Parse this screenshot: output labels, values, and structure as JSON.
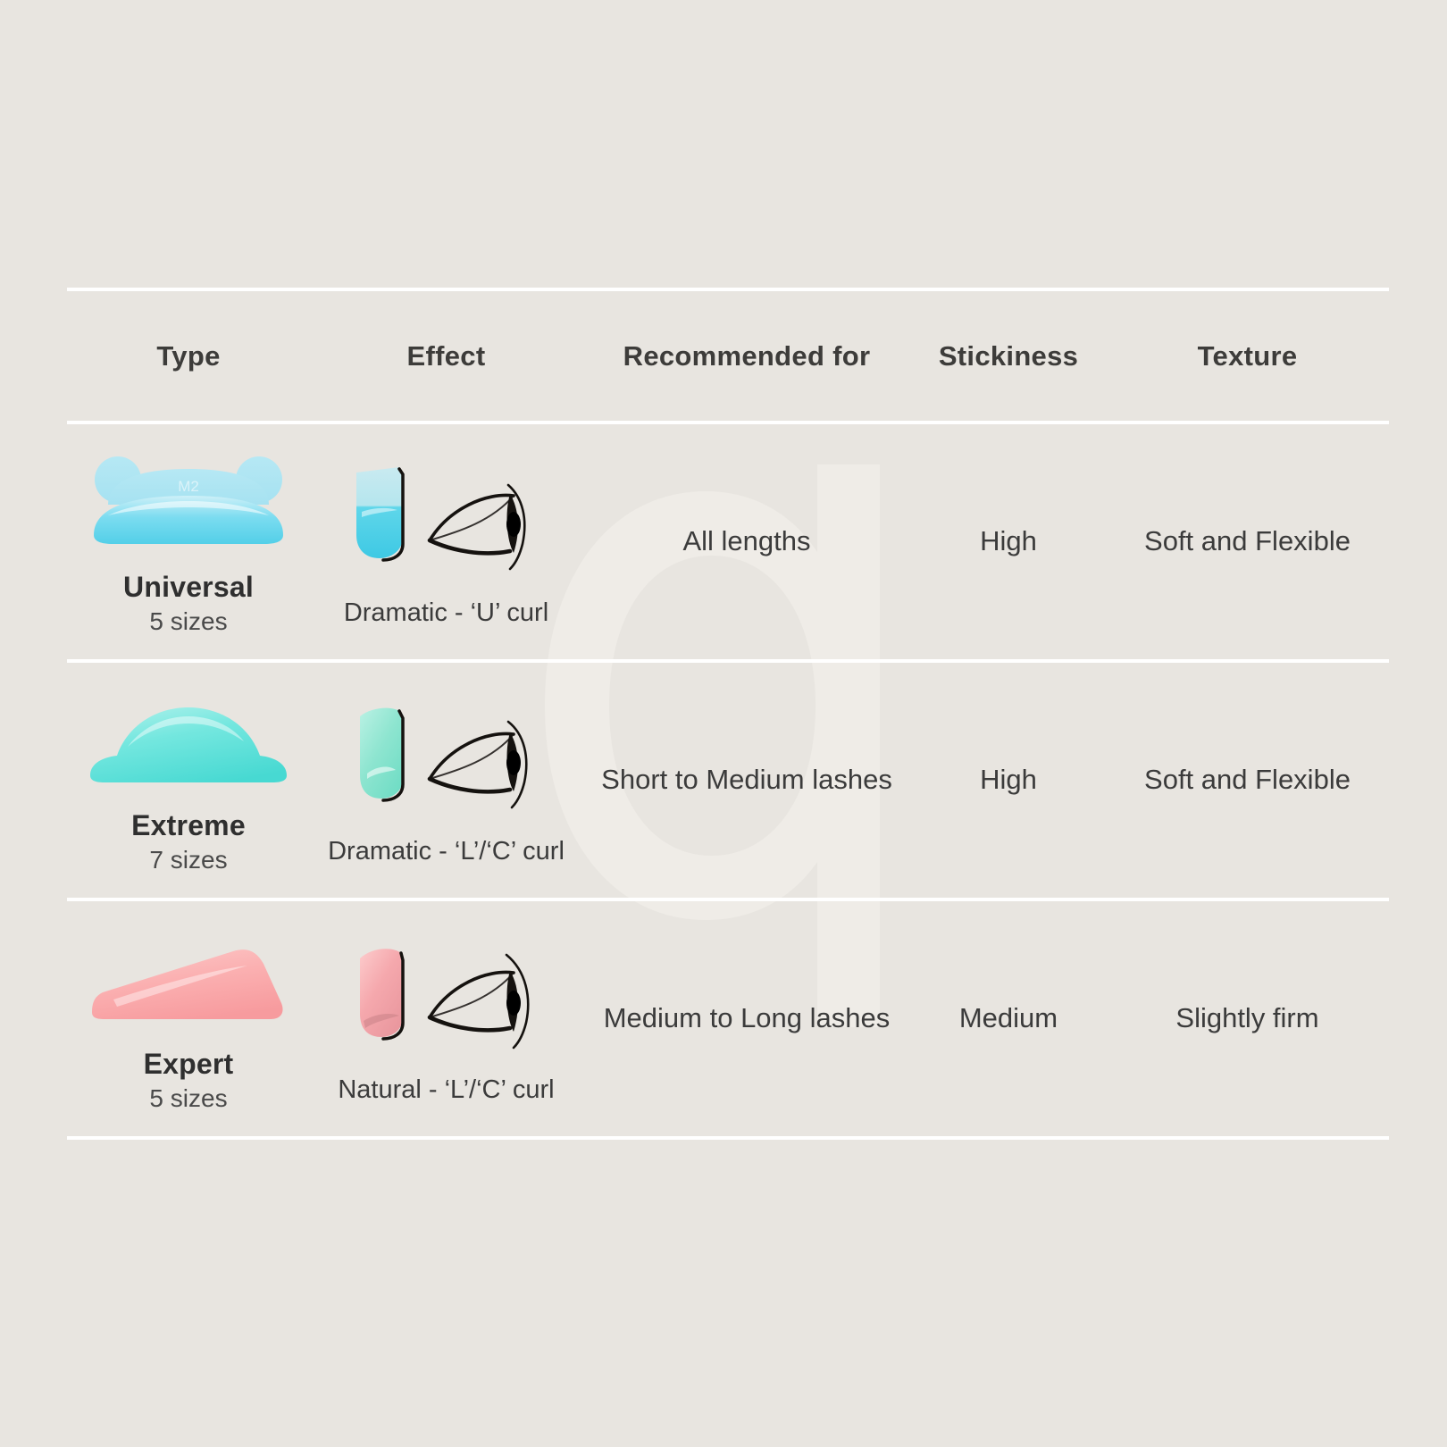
{
  "page": {
    "background_color": "#e8e5e0",
    "divider_color": "#ffffff",
    "watermark_letter": "a"
  },
  "table": {
    "headers": [
      {
        "key": "type",
        "label": "Type"
      },
      {
        "key": "effect",
        "label": "Effect"
      },
      {
        "key": "recommend",
        "label": "Recommended for"
      },
      {
        "key": "sticky",
        "label": "Stickiness"
      },
      {
        "key": "texture",
        "label": "Texture"
      }
    ],
    "rows": [
      {
        "type_name": "Universal",
        "type_sizes": "5 sizes",
        "pad_label": "M2",
        "pad_color": "#9fe4f2",
        "pad_color_deep": "#55cde8",
        "swatch_color": "#4fd4ec",
        "swatch_color_light": "#b9e8ef",
        "effect_label": "Dramatic - ‘U’ curl",
        "recommended_for": "All lengths",
        "stickiness": "High",
        "texture": "Soft and Flexible"
      },
      {
        "type_name": "Extreme",
        "type_sizes": "7 sizes",
        "pad_label": "",
        "pad_color": "#74e7df",
        "pad_color_deep": "#4fdcd4",
        "swatch_color": "#8ee5d0",
        "swatch_color_light": "#b6f0e2",
        "effect_label": "Dramatic - ‘L’/‘C’ curl",
        "recommended_for": "Short to Medium lashes",
        "stickiness": "High",
        "texture": "Soft and Flexible"
      },
      {
        "type_name": "Expert",
        "type_sizes": "5 sizes",
        "pad_label": "",
        "pad_color": "#fbb6b6",
        "pad_color_deep": "#f79d9f",
        "swatch_color": "#f5a8ad",
        "swatch_color_light": "#fcc8c9",
        "effect_label": "Natural - ‘L’/‘C’ curl",
        "recommended_for": "Medium to Long lashes",
        "stickiness": "Medium",
        "texture": "Slightly firm"
      }
    ]
  }
}
